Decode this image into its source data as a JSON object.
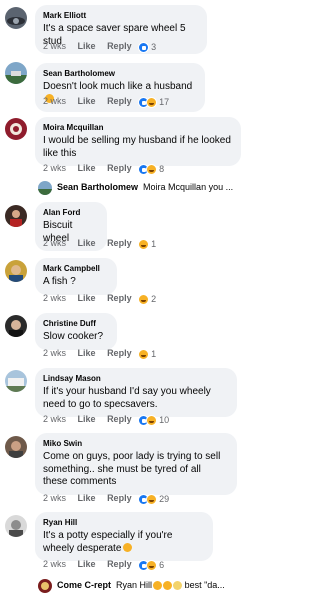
{
  "actions": {
    "like": "Like",
    "reply": "Reply"
  },
  "comments": [
    {
      "author": "Mark Elliott",
      "text": "It's a space saver spare wheel 5 stud",
      "time": "2 wks",
      "reactions": "like",
      "count": "3"
    },
    {
      "author": "Sean Bartholomew",
      "text": "Doesn't look much like a husband",
      "time": "2 wks",
      "reactions": "like+haha",
      "count": "17"
    },
    {
      "author": "Moira Mcquillan",
      "text": "I would be selling my husband if he looked like this",
      "time": "2 wks",
      "reactions": "like+haha",
      "count": "8"
    },
    {
      "author": "Alan Ford",
      "text": "Biscuit wheel",
      "time": "2 wks",
      "reactions": "haha",
      "count": "1"
    },
    {
      "author": "Mark Campbell",
      "text": "A fish ?",
      "time": "2 wks",
      "reactions": "haha",
      "count": "2"
    },
    {
      "author": "Christine Duff",
      "text": "Slow cooker?",
      "time": "2 wks",
      "reactions": "haha",
      "count": "1"
    },
    {
      "author": "Lindsay Mason",
      "text": "If it's your husband I'd say you wheely need to go to specsavers.",
      "time": "2 wks",
      "reactions": "like+haha",
      "count": "10"
    },
    {
      "author": "Miko Swin",
      "text": "Come on guys, poor lady is trying to sell something.. she must be tyred of all these comments",
      "time": "2 wks",
      "reactions": "like+haha",
      "count": "29"
    },
    {
      "author": "Ryan Hill",
      "text": "It's a potty especially if you're wheely desperate",
      "time": "2 wks",
      "reactions": "like+haha",
      "count": "6"
    }
  ],
  "replies": [
    {
      "author": "Sean Bartholomew",
      "text": "Moira Mcquillan you ..."
    },
    {
      "author": "Come C-rept",
      "text": "Ryan Hill",
      "suffix": "best \"da..."
    }
  ]
}
